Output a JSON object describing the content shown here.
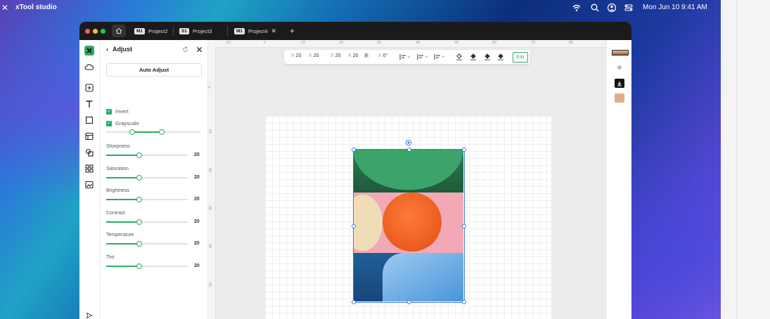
{
  "menubar": {
    "app_close": "✕",
    "app_name": "xTool studio",
    "clock": "Mon Jun 10  9:41 AM"
  },
  "tabs": [
    {
      "badge": "M1",
      "label": "Project2"
    },
    {
      "badge": "S1",
      "label": "Project3"
    },
    {
      "badge": "M1",
      "label": "Project4",
      "close": "✕"
    }
  ],
  "add_tab": "+",
  "panel": {
    "title": "Adjust",
    "auto_adjust": "Auto Adjust",
    "invert": {
      "label": "Invert",
      "checked": true
    },
    "grayscale": {
      "label": "Grayscale",
      "checked": true
    },
    "sliders": [
      {
        "label": "Sharpness",
        "value": "20"
      },
      {
        "label": "Saturation",
        "value": "20"
      },
      {
        "label": "Brightness",
        "value": "20"
      },
      {
        "label": "Contrast",
        "value": "20"
      },
      {
        "label": "Temperature",
        "value": "20"
      },
      {
        "label": "Tint",
        "value": "20"
      }
    ]
  },
  "toolbar": {
    "x1k": "X",
    "x1v": "20",
    "x2k": "X",
    "x2v": "20",
    "x3k": "X",
    "x3v": "20",
    "x4k": "X",
    "x4v": "20",
    "lock": "8",
    "rotk": "X",
    "rotv": "0°",
    "edit": "Edit"
  },
  "ruler_top": [
    "-10",
    "0",
    "10",
    "20",
    "30",
    "40",
    "50",
    "60",
    "70",
    "80"
  ],
  "ruler_left": [
    "0",
    "10",
    "20",
    "30",
    "40",
    "50",
    "60"
  ],
  "colors": {
    "accent": "#27ae60",
    "selection": "#3b7be0",
    "titlebar": "#1b1b1d"
  }
}
